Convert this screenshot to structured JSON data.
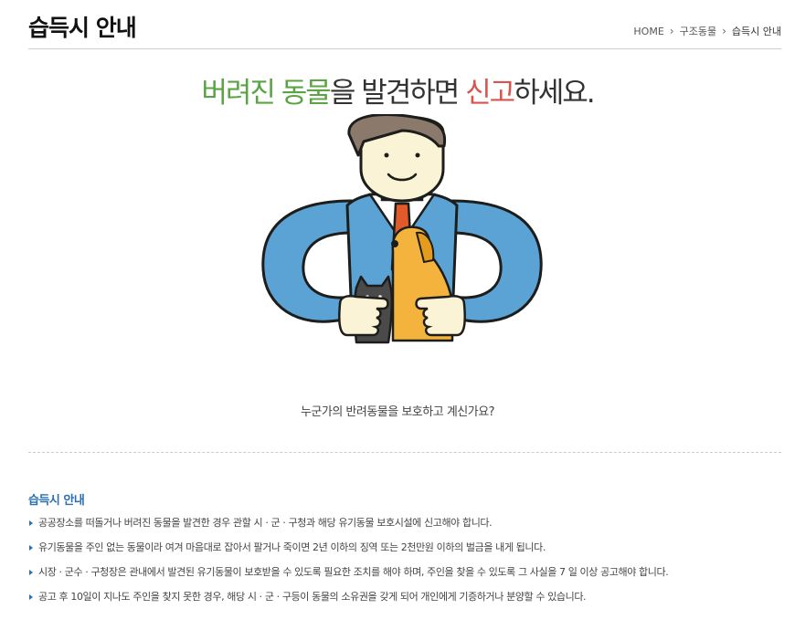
{
  "header": {
    "title": "습득시 안내",
    "breadcrumb": [
      "HOME",
      "구조동물",
      "습득시 안내"
    ]
  },
  "headline": {
    "part1": "버려진 동물",
    "part2": "을 발견하면 ",
    "part3": "신고",
    "part4": "하세요."
  },
  "question": "누군가의 반려동물을 보호하고 계신가요?",
  "section": {
    "title": "습득시 안내",
    "items": [
      "공공장소를 떠돌거나 버려진 동물을 발견한 경우 관할 시 · 군 · 구청과 해당 유기동물 보호시설에 신고해야 합니다.",
      "유기동물을 주인 없는 동물이라 여겨 마음대로 잡아서 팔거나 죽이면 2년 이하의 징역 또는 2천만원 이하의 벌금을 내게 됩니다.",
      "시장 · 군수 · 구청장은 관내에서 발견된 유기동물이 보호받을 수 있도록 필요한 조치를 해야 하며, 주인을 찾을 수 있도록 그 사실을 7 일 이상 공고해야 합니다.",
      "공고 후 10일이 지나도 주인을 찾지 못한 경우, 해당 시 · 군 · 구등이 동물의 소유권을 갖게 되어 개인에게 기증하거나 분양할 수 있습니다."
    ]
  },
  "colors": {
    "green": "#5aa444",
    "red": "#d9534f",
    "blue": "#2a6fb0",
    "suit": "#5ba3d4",
    "dog": "#f3b33d"
  },
  "illustration": {
    "icon": "man-hugging-dog-and-cat-illustration"
  }
}
